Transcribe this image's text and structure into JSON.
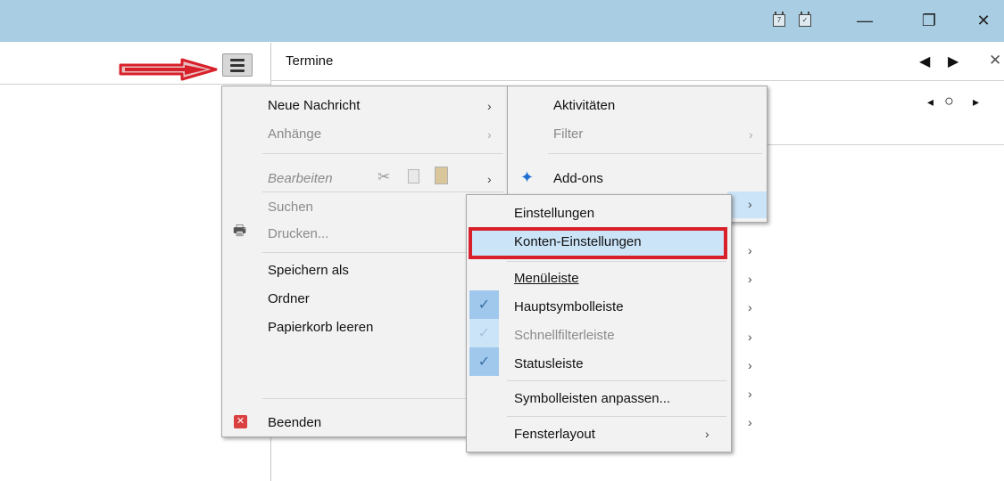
{
  "window": {
    "controls": {
      "minimize": "—",
      "restore": "❐",
      "close": "✕"
    },
    "title_icons": [
      "calendar-icon",
      "task-icon"
    ]
  },
  "termine": {
    "title": "Termine",
    "nav_prev": "◀",
    "nav_next": "▶",
    "close": "✕",
    "day_prev": "◂",
    "today": "○",
    "day_next": "▸"
  },
  "main_menu": {
    "items": [
      {
        "label": "Neue Nachricht",
        "enabled": true,
        "submenu": true
      },
      {
        "label": "Anhänge",
        "enabled": false,
        "submenu": true
      },
      {
        "label": "Bearbeiten",
        "enabled": false,
        "submenu": true
      },
      {
        "label": "Suchen",
        "enabled": false
      },
      {
        "label": "Drucken...",
        "enabled": false
      },
      {
        "label": "Speichern als",
        "enabled": true
      },
      {
        "label": "Ordner",
        "enabled": true
      },
      {
        "label": "Papierkorb leeren",
        "enabled": true
      },
      {
        "label": "Beenden",
        "enabled": true
      }
    ]
  },
  "tools_menu": {
    "items": [
      {
        "label": "Aktivitäten",
        "enabled": true
      },
      {
        "label": "Filter",
        "enabled": false,
        "submenu": true
      },
      {
        "label": "Add-ons",
        "enabled": true
      }
    ]
  },
  "view_menu": {
    "items": [
      {
        "label": "Einstellungen",
        "checked": false
      },
      {
        "label": "Konten-Einstellungen",
        "highlighted": true
      },
      {
        "label": "Menüleiste",
        "checked": false
      },
      {
        "label": "Hauptsymbolleiste",
        "checked": true
      },
      {
        "label": "Schnellfilterleiste",
        "checked": true,
        "enabled": false
      },
      {
        "label": "Statusleiste",
        "checked": true
      },
      {
        "label": "Symbolleisten anpassen...",
        "checked": false
      },
      {
        "label": "Fensterlayout",
        "submenu": true
      }
    ]
  },
  "colors": {
    "titlebar": "#a9cee3",
    "highlight": "#cce4f7",
    "annotation": "#d8202a"
  }
}
